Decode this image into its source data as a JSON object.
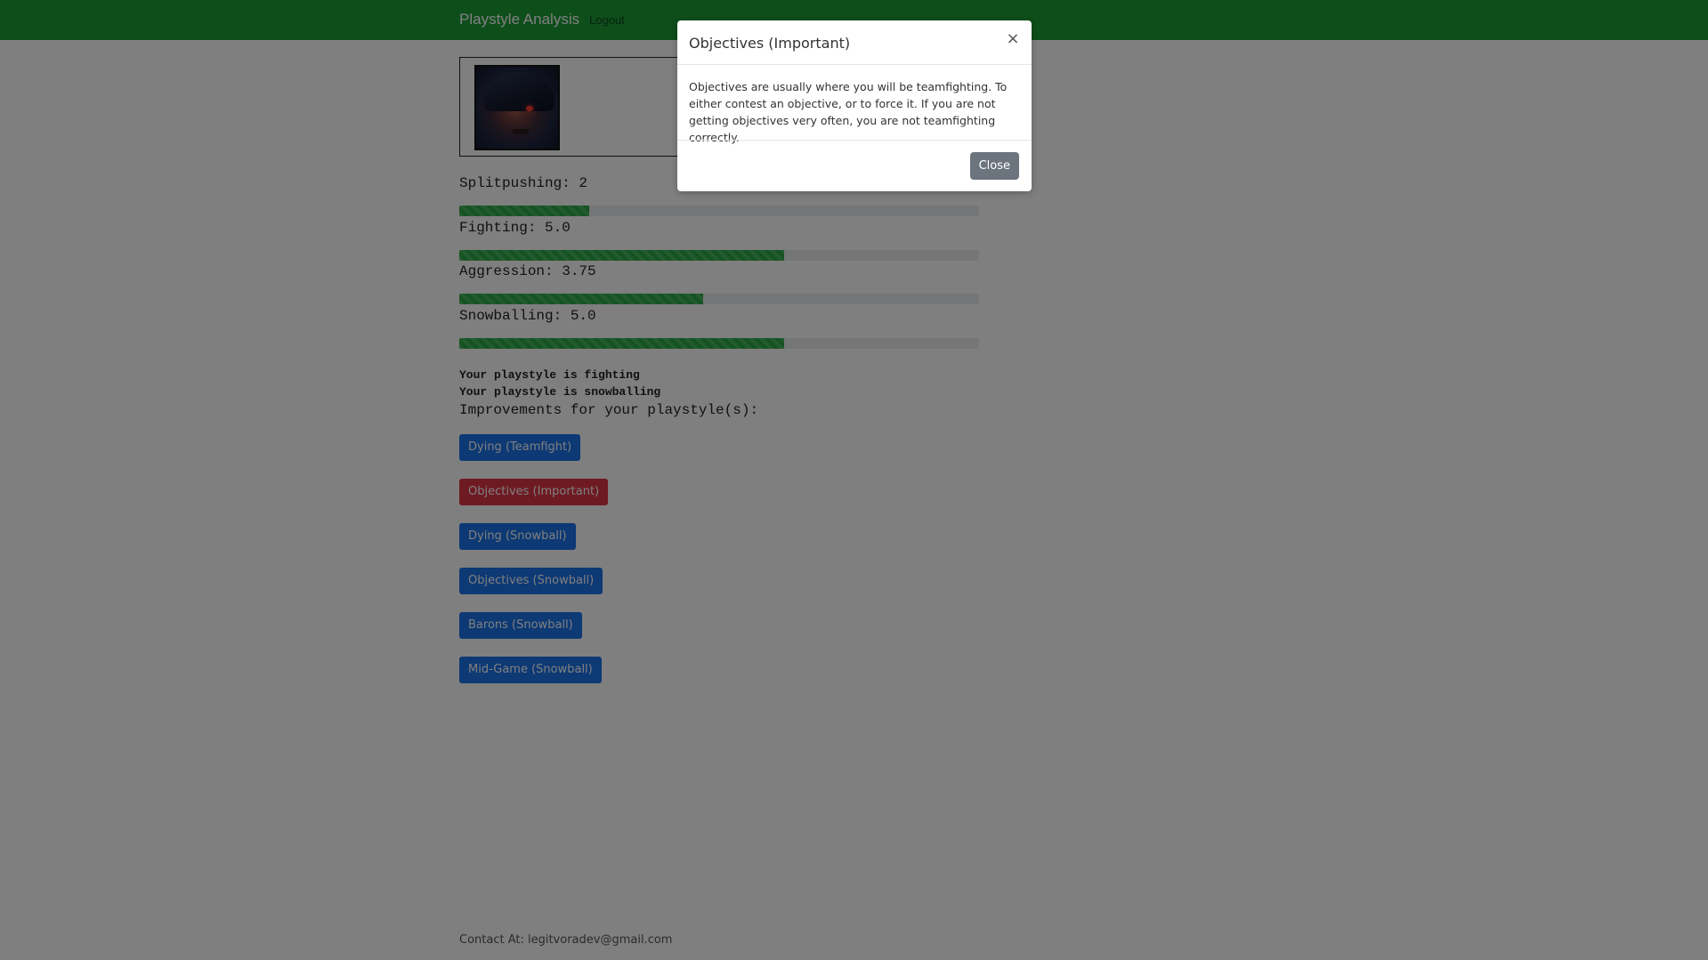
{
  "navbar": {
    "brand": "Playstyle Analysis",
    "logout": "Logout"
  },
  "profile": {
    "avatar_icon": "champion-portrait"
  },
  "stats": [
    {
      "label": "Splitpushing: 2",
      "value": 2,
      "progress_percent": 25
    },
    {
      "label": "Fighting: 5.0",
      "value": 5.0,
      "progress_percent": 62.5
    },
    {
      "label": "Aggression: 3.75",
      "value": 3.75,
      "progress_percent": 47
    },
    {
      "label": "Snowballing: 5.0",
      "value": 5.0,
      "progress_percent": 62.5
    }
  ],
  "playstyles": [
    "Your playstyle is fighting",
    "Your playstyle is snowballing"
  ],
  "improvements": {
    "title": "Improvements for your playstyle(s):",
    "buttons": [
      {
        "label": "Dying (Teamfight)",
        "color": "#1a73e8"
      },
      {
        "label": "Objectives (Important)",
        "color": "#dc3545"
      },
      {
        "label": "Dying (Snowball)",
        "color": "#1a73e8"
      },
      {
        "label": "Objectives (Snowball)",
        "color": "#1a73e8"
      },
      {
        "label": "Barons (Snowball)",
        "color": "#1a73e8"
      },
      {
        "label": "Mid-Game (Snowball)",
        "color": "#1a73e8"
      }
    ]
  },
  "footer": {
    "contact": "Contact At: legitvoradev@gmail.com"
  },
  "modal": {
    "title": "Objectives (Important)",
    "body": "Objectives are usually where you will be teamfighting. To either contest an objective, or to force it. If you are not getting objectives very often, you are not teamfighting correctly.",
    "close_label": "Close",
    "close_icon": "close-icon"
  },
  "colors": {
    "navbar": "#1c9c37",
    "progress": "#28a745",
    "primary": "#1a73e8",
    "danger": "#dc3545",
    "secondary": "#6c757d"
  }
}
